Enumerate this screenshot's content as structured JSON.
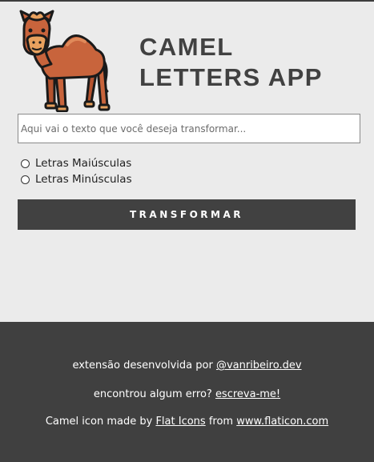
{
  "app": {
    "title": "CAMEL LETTERS APP",
    "logo_icon": "camel-icon"
  },
  "input": {
    "placeholder": "Aqui vai o texto que você deseja transformar...",
    "value": ""
  },
  "options": [
    {
      "label": "Letras Maiúsculas",
      "selected": false
    },
    {
      "label": "Letras Minúsculas",
      "selected": false
    }
  ],
  "button": {
    "label": "TRANSFORMAR"
  },
  "footer": {
    "credit_text": "extensão desenvolvida por",
    "credit_link": "@vanribeiro.dev",
    "bug_text": "encontrou algum erro?",
    "bug_link": "escreva-me!",
    "icon_text_1": "Camel icon made by",
    "icon_author_link": "Flat Icons",
    "icon_text_2": "from",
    "icon_site_link": "www.flaticon.com"
  },
  "colors": {
    "background": "#ebebeb",
    "dark": "#404040",
    "camel_body": "#c8643c",
    "camel_outline": "#1a1a1a"
  }
}
